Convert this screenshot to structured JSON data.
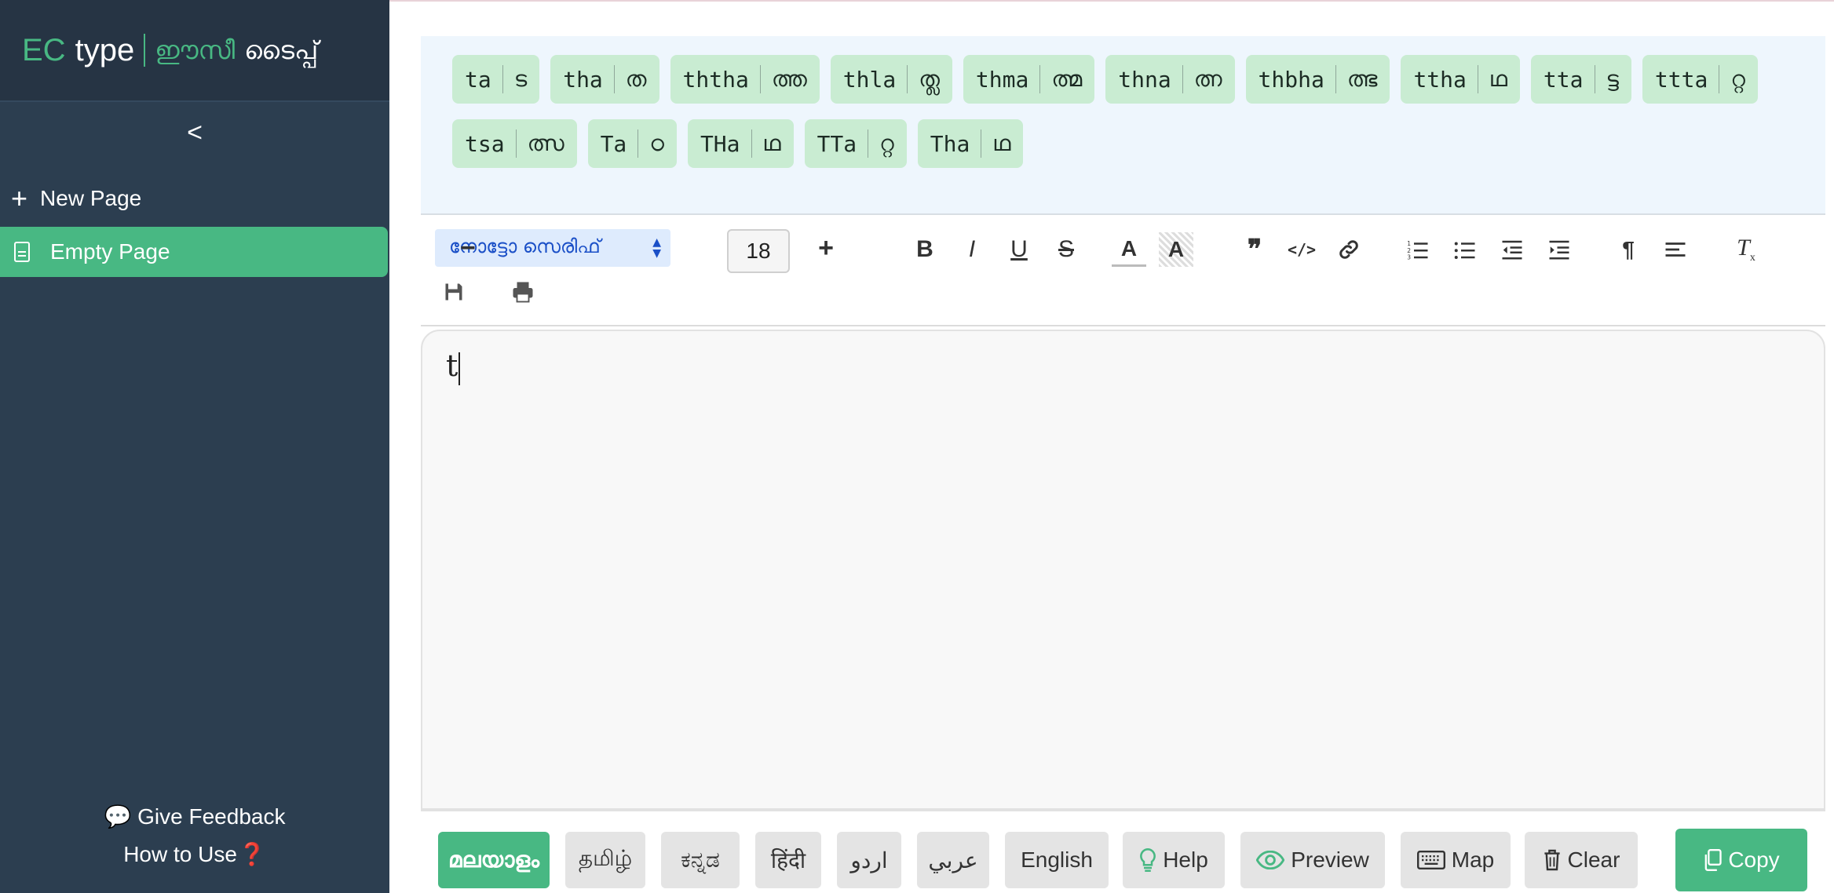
{
  "brand": {
    "ec": "EC",
    "type": "type",
    "malayalam_1": "ഈസീ",
    "malayalam_2": "ടൈപ്പ്"
  },
  "sidebar": {
    "collapse_label": "<",
    "new_page_label": "New Page",
    "pages": [
      {
        "label": "Empty Page",
        "active": true
      }
    ],
    "feedback_icon": "💬",
    "feedback_label": "Give Feedback",
    "how_to_label": "How to Use",
    "how_to_icon": "❓"
  },
  "suggestions": [
    {
      "latin": "ta",
      "mal": "ട"
    },
    {
      "latin": "tha",
      "mal": "ത"
    },
    {
      "latin": "ththa",
      "mal": "ത്ത"
    },
    {
      "latin": "thla",
      "mal": "ത്ല"
    },
    {
      "latin": "thma",
      "mal": "ത്മ"
    },
    {
      "latin": "thna",
      "mal": "ത്ന"
    },
    {
      "latin": "thbha",
      "mal": "ത്ഭ"
    },
    {
      "latin": "ttha",
      "mal": "ഥ"
    },
    {
      "latin": "tta",
      "mal": "ട്ട"
    },
    {
      "latin": "ttta",
      "mal": "റ്റ"
    },
    {
      "latin": "tsa",
      "mal": "ത്സ"
    },
    {
      "latin": "Ta",
      "mal": "ഠ"
    },
    {
      "latin": "THa",
      "mal": "ഥ"
    },
    {
      "latin": "TTa",
      "mal": "റ്റ"
    },
    {
      "latin": "Tha",
      "mal": "ഥ"
    }
  ],
  "toolbar": {
    "font_family": "നോട്ടോ സെരിഫ്",
    "decrease_label": "−",
    "font_size": "18",
    "increase_label": "+",
    "bold": "B",
    "italic": "I",
    "underline": "U",
    "strike": "S",
    "text_color": "A",
    "highlight": "A",
    "quote": "❞",
    "code": "</>",
    "paragraph": "¶",
    "clear_format": "T"
  },
  "editor": {
    "content": "t"
  },
  "bottom_bar": {
    "languages": [
      {
        "label": "മലയാളം",
        "active": true
      },
      {
        "label": "தமிழ்",
        "active": false
      },
      {
        "label": "ಕನ್ನಡ",
        "active": false
      },
      {
        "label": "हिंदी",
        "active": false
      },
      {
        "label": "اردو",
        "active": false
      },
      {
        "label": "عربي",
        "active": false
      },
      {
        "label": "English",
        "active": false
      }
    ],
    "help_label": "Help",
    "preview_label": "Preview",
    "map_label": "Map",
    "clear_label": "Clear",
    "copy_label": "Copy"
  },
  "colors": {
    "sidebar_bg": "#2c3e50",
    "accent_green": "#48b883",
    "chip_bg": "#c9ecd2",
    "suggestion_panel_bg": "#eef6fd"
  }
}
